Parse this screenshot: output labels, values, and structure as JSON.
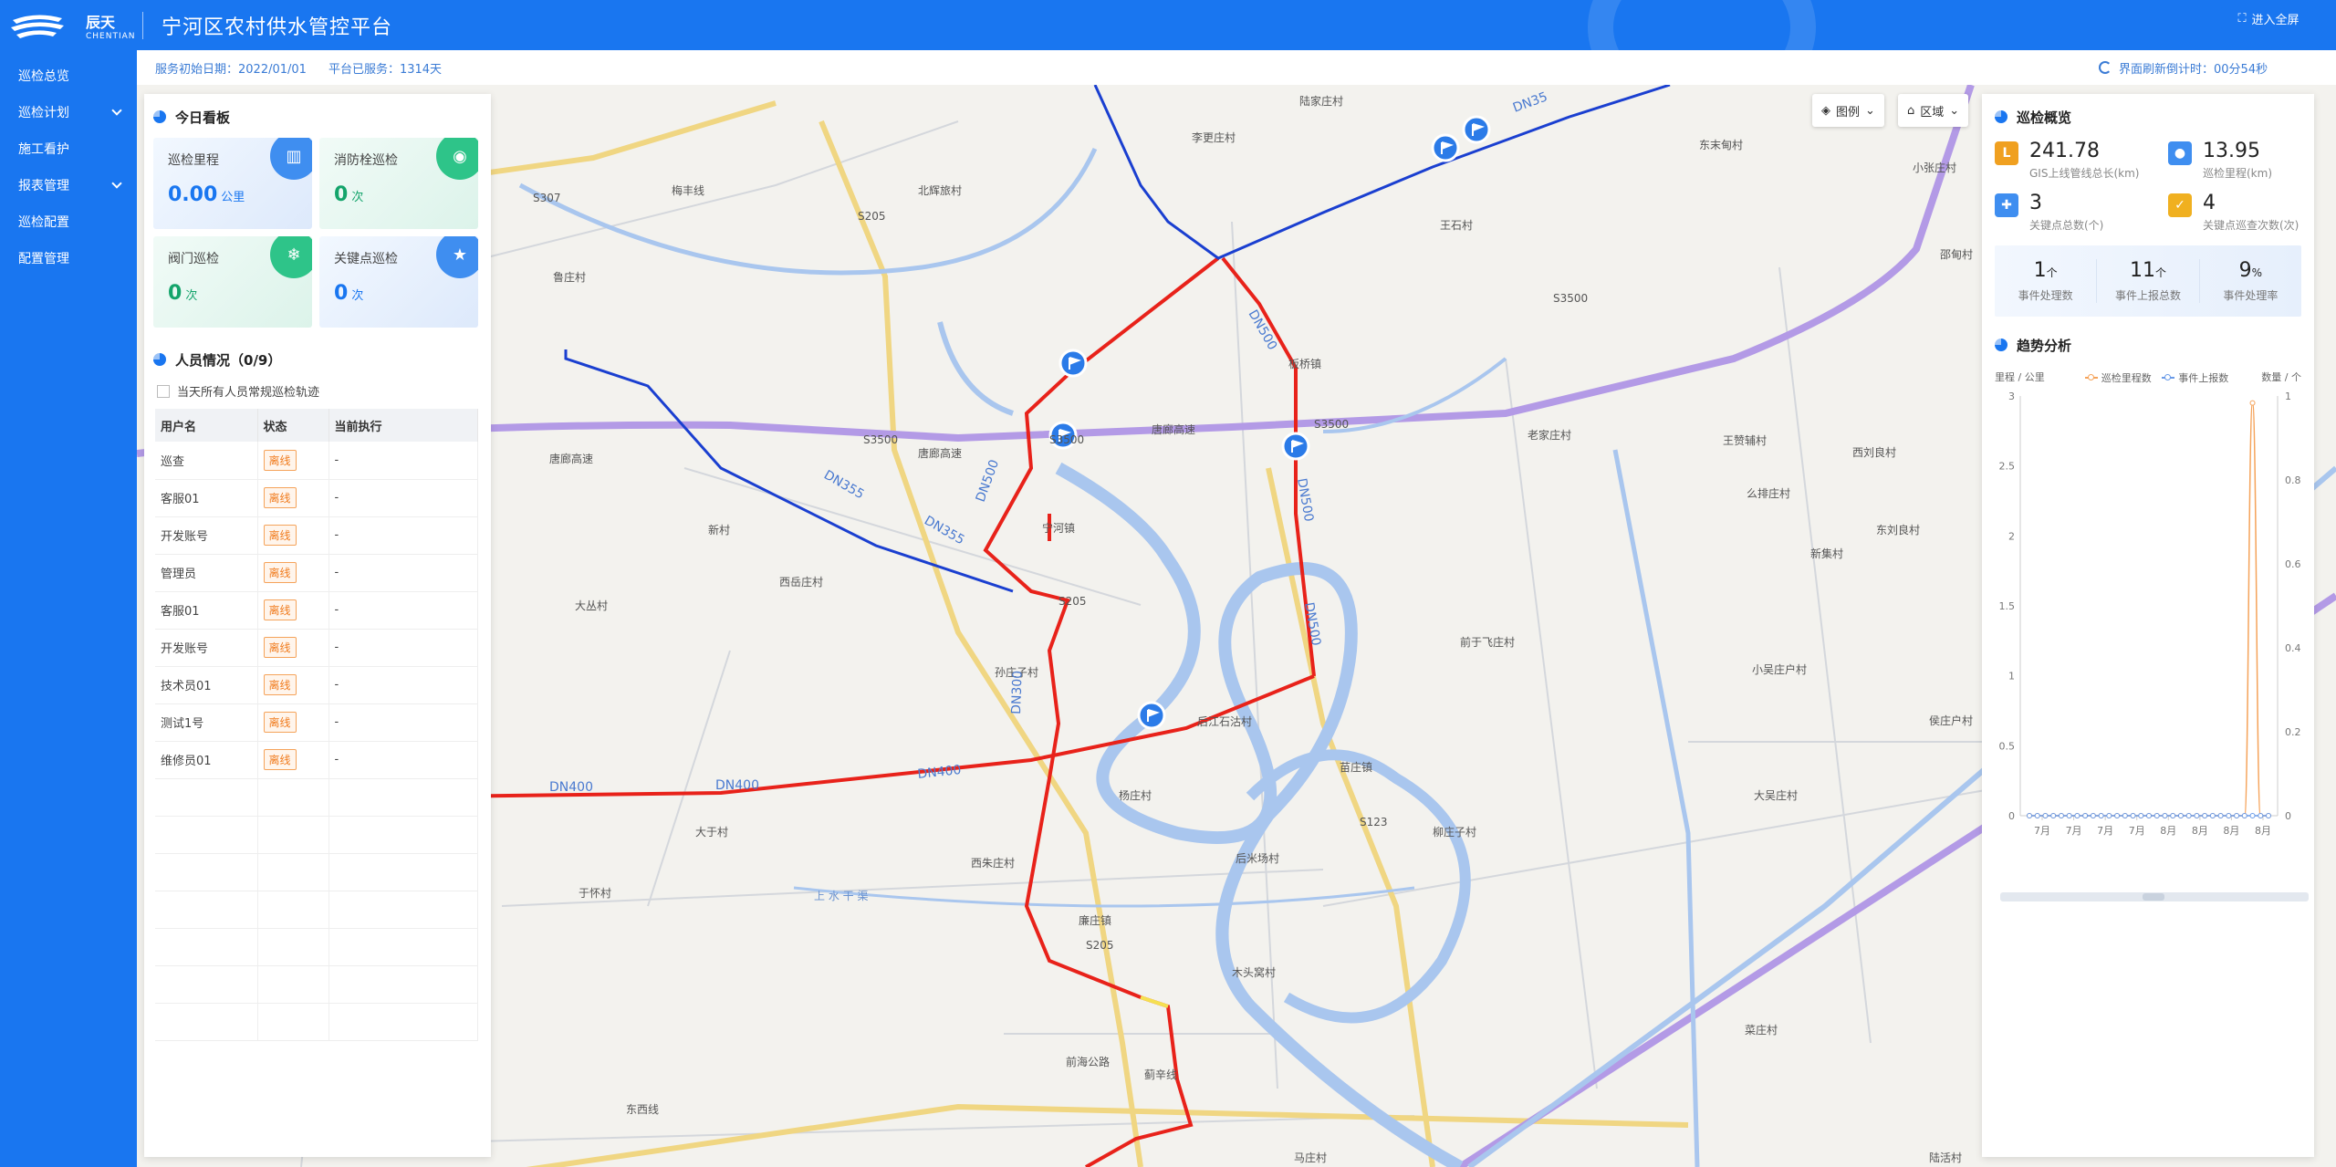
{
  "header": {
    "logo_cn": "辰天",
    "logo_en": "CHENTIAN",
    "title": "宁河区农村供水管控平台"
  },
  "sidebar": {
    "items": [
      {
        "label": "巡检总览",
        "has_children": false
      },
      {
        "label": "巡检计划",
        "has_children": true
      },
      {
        "label": "施工看护",
        "has_children": false
      },
      {
        "label": "报表管理",
        "has_children": true
      },
      {
        "label": "巡检配置",
        "has_children": false
      },
      {
        "label": "配置管理",
        "has_children": false
      }
    ]
  },
  "infobar": {
    "service_start": "服务初始日期：2022/01/01",
    "service_days": "平台已服务：1314天",
    "refresh_countdown": "界面刷新倒计时：00分54秒",
    "fullscreen_label": "进入全屏"
  },
  "map_controls": {
    "legend_label": "图例",
    "region_label": "区域"
  },
  "today_board": {
    "title": "今日看板",
    "cards": [
      {
        "label": "巡检里程",
        "value": "0.00",
        "unit": "公里",
        "icon": "road-icon"
      },
      {
        "label": "消防栓巡检",
        "value": "0",
        "unit": "次",
        "icon": "hydrant-icon"
      },
      {
        "label": "阀门巡检",
        "value": "0",
        "unit": "次",
        "icon": "valve-icon"
      },
      {
        "label": "关键点巡检",
        "value": "0",
        "unit": "次",
        "icon": "keypoint-icon"
      }
    ]
  },
  "personnel": {
    "title": "人员情况（0/9）",
    "checkbox_label": "当天所有人员常规巡检轨迹",
    "columns": [
      "用户名",
      "状态",
      "当前执行"
    ],
    "rows": [
      {
        "user": "巡查",
        "status": "离线",
        "task": "-"
      },
      {
        "user": "客服01",
        "status": "离线",
        "task": "-"
      },
      {
        "user": "开发账号",
        "status": "离线",
        "task": "-"
      },
      {
        "user": "管理员",
        "status": "离线",
        "task": "-"
      },
      {
        "user": "客服01",
        "status": "离线",
        "task": "-"
      },
      {
        "user": "开发账号",
        "status": "离线",
        "task": "-"
      },
      {
        "user": "技术员01",
        "status": "离线",
        "task": "-"
      },
      {
        "user": "测试1号",
        "status": "离线",
        "task": "-"
      },
      {
        "user": "维修员01",
        "status": "离线",
        "task": "-"
      }
    ]
  },
  "overview": {
    "title": "巡检概览",
    "items": [
      {
        "value": "241.78",
        "label": "GIS上线管线总长(km)",
        "color": "#f0a020"
      },
      {
        "value": "13.95",
        "label": "巡检里程(km)",
        "color": "#3f8ef0"
      },
      {
        "value": "3",
        "label": "关键点总数(个)",
        "color": "#3f8ef0"
      },
      {
        "value": "4",
        "label": "关键点巡查次数(次)",
        "color": "#f0b020"
      }
    ],
    "stats": [
      {
        "value": "1",
        "unit": "个",
        "label": "事件处理数"
      },
      {
        "value": "11",
        "unit": "个",
        "label": "事件上报总数"
      },
      {
        "value": "9",
        "unit": "%",
        "label": "事件处理率"
      }
    ]
  },
  "trend": {
    "title": "趋势分析",
    "left_unit": "里程 / 公里",
    "right_unit": "数量 / 个",
    "legend": [
      "巡检里程数",
      "事件上报数"
    ]
  },
  "chart_data": {
    "type": "line",
    "categories": [
      "7月",
      "7月",
      "7月",
      "7月",
      "7月",
      "7月",
      "7月",
      "7月",
      "7月",
      "7月",
      "7月",
      "7月",
      "7月",
      "7月",
      "7月",
      "7月",
      "8月",
      "8月",
      "8月",
      "8月",
      "8月",
      "8月",
      "8月",
      "8月",
      "8月",
      "8月",
      "8月",
      "8月",
      "8月",
      "8月",
      "8月"
    ],
    "x_tick_labels": [
      "7月",
      "7月",
      "7月",
      "7月",
      "8月",
      "8月",
      "8月",
      "8月"
    ],
    "series": [
      {
        "name": "巡检里程数",
        "axis": "left",
        "color": "#f5a35a",
        "values": [
          0,
          0,
          0,
          0,
          0,
          0,
          0,
          0,
          0,
          0,
          0,
          0,
          0,
          0,
          0,
          0,
          0,
          0,
          0,
          0,
          0,
          0,
          0,
          0,
          0,
          0,
          0,
          0,
          2.95,
          0,
          0
        ]
      },
      {
        "name": "事件上报数",
        "axis": "right",
        "color": "#6a9be8",
        "values": [
          0,
          0,
          0,
          0,
          0,
          0,
          0,
          0,
          0,
          0,
          0,
          0,
          0,
          0,
          0,
          0,
          0,
          0,
          0,
          0,
          0,
          0,
          0,
          0,
          0,
          0,
          0,
          0,
          0,
          0,
          0
        ]
      }
    ],
    "y_left": {
      "min": 0,
      "max": 3,
      "ticks": [
        0,
        0.5,
        1,
        1.5,
        2,
        2.5,
        3
      ]
    },
    "y_right": {
      "min": 0,
      "max": 1,
      "ticks": [
        0,
        0.2,
        0.4,
        0.6,
        0.8,
        1
      ]
    },
    "grid": false
  },
  "map_labels": [
    "陆家庄村",
    "李更庄村",
    "东末甸村",
    "小张庄村",
    "王石村",
    "邵甸村",
    "北辉旅村",
    "鲁庄村",
    "板桥镇",
    "老家庄村",
    "王赞辅村",
    "西刘良村",
    "么排庄村",
    "东刘良村",
    "新集村",
    "新村",
    "宁河镇",
    "西岳庄村",
    "大丛村",
    "前于飞庄村",
    "小吴庄户村",
    "孙庄子村",
    "后江石沽村",
    "苗庄镇",
    "侯庄户村",
    "杨庄村",
    "柳庄子村",
    "大吴庄村",
    "大于村",
    "西朱庄村",
    "于怀村",
    "后米场村",
    "廉庄镇",
    "木头窝村",
    "菜庄村",
    "东西线",
    "马庄村",
    "陆活村",
    "蓟辛线",
    "梅丰线"
  ],
  "pipe_labels": [
    "DN400",
    "DN400",
    "DN400",
    "DN355",
    "DN355",
    "DN500",
    "DN500",
    "DN500",
    "DN500",
    "DN300",
    "DN35"
  ],
  "road_labels": [
    "唐廊高速",
    "唐廊高速",
    "唐廊高速",
    "S3500",
    "S3500",
    "S3500",
    "S3500",
    "S205",
    "S205",
    "S205",
    "S307",
    "S123",
    "前海公路",
    "上 水 干 渠"
  ],
  "colors": {
    "primary": "#1976f0",
    "pipe_red": "#e8221a",
    "pipe_blue": "#1a3fd0",
    "expressway": "#b39ae6"
  }
}
